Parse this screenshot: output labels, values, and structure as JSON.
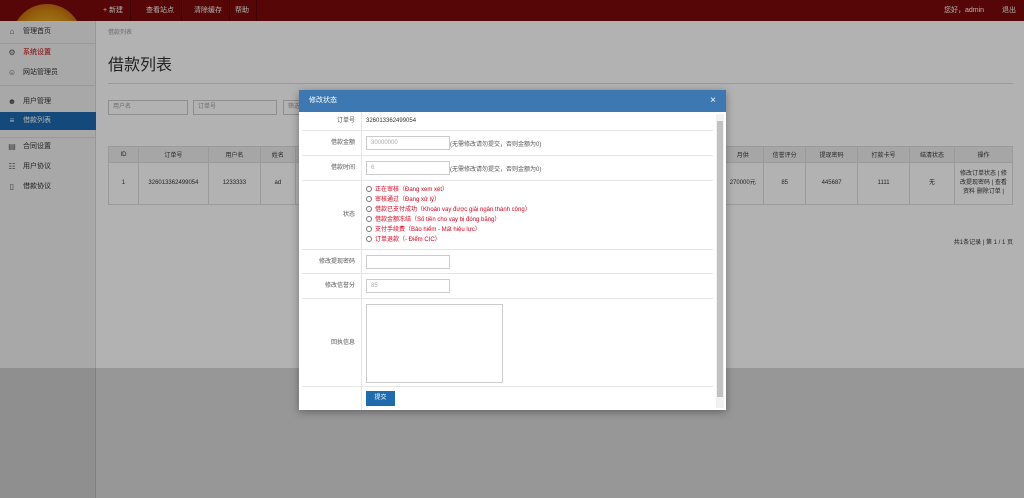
{
  "topbar": {
    "items": [
      "+ 新建",
      "查看站点",
      "清除缓存",
      "帮助"
    ],
    "greeting": "您好，admin",
    "logout": "退出"
  },
  "sidebar": {
    "items": [
      {
        "icon": "home-icon",
        "label": "管理首页"
      },
      {
        "icon": "gear-icon",
        "label": "系统设置"
      },
      {
        "icon": "user-icon",
        "label": "网站管理员"
      },
      {
        "icon": "users-icon",
        "label": "用户管理"
      },
      {
        "icon": "list-icon",
        "label": "借款列表"
      },
      {
        "icon": "contract-icon",
        "label": "合同设置"
      },
      {
        "icon": "user-agreement-icon",
        "label": "用户协议"
      },
      {
        "icon": "document-icon",
        "label": "借款协议"
      }
    ]
  },
  "main": {
    "breadcrumb": "借款列表",
    "title": "借款列表",
    "filters": [
      "用户名",
      "订单号",
      "筛选"
    ],
    "table": {
      "headers": [
        "ID",
        "订单号",
        "用户名",
        "姓名",
        "月供",
        "信誉评分",
        "提现密码",
        "打款卡号",
        "结清状态",
        "操作"
      ],
      "row": [
        "1",
        "326013362499054",
        "1233333",
        "ad",
        "270000元",
        "85",
        "445687",
        "1111",
        "无",
        "修改订单状态 | 修改提现密码 | 查看资料 删除订单 |"
      ]
    },
    "pager": "共1条记录 | 第 1 / 1 页"
  },
  "modal": {
    "title": "修改状态",
    "close": "×",
    "fields": {
      "order_no_label": "订单号",
      "order_no_value": "326013362499054",
      "amount_label": "借款金额",
      "amount_value": "30000000",
      "amount_note": "(无需修改请勿提交，否则金额为0)",
      "term_label": "借款时间",
      "term_value": "6",
      "term_note": "(无需修改请勿提交，否则金额为0)",
      "status_label": "状态",
      "status_options": [
        "正在审核（Đang xem xét）",
        "审核通过（Đang xử lý）",
        "借款已支付成功（Khoản vay được giải ngân thành công）",
        "借款金额冻结（Số tiền cho vay bị đóng băng）",
        "支付手续费（Bảo hiểm - Mất hiệu lực）",
        "订单退款（- Điểm CIC）"
      ],
      "withdraw_pwd_label": "修改提现密码",
      "withdraw_pwd_value": "",
      "credit_label": "修改信誉分",
      "credit_value": "85",
      "feedback_label": "回执信息",
      "submit": "提交"
    }
  },
  "colors": {
    "topbar": "#7c0a0a",
    "accent": "#1e6bb0",
    "modal_header": "#3d78b2",
    "status_text": "#d9001b"
  }
}
